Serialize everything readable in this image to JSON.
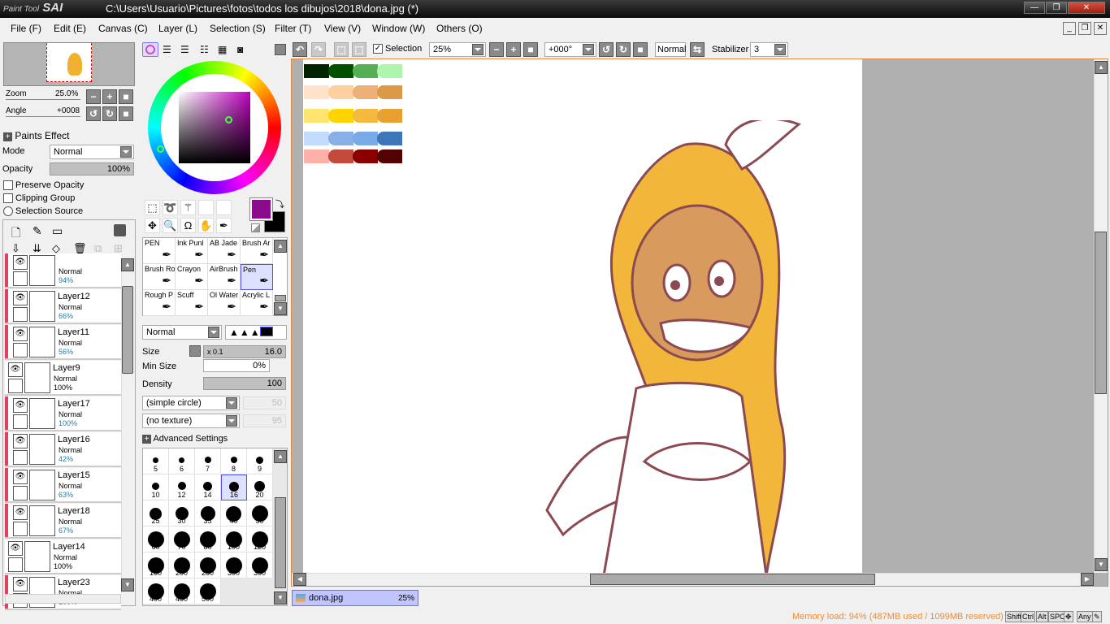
{
  "app": {
    "logo": "PaintTool SAI",
    "title": "C:\\Users\\Usuario\\Pictures\\fotos\\todos los dibujos\\2018\\dona.jpg (*)"
  },
  "menu": [
    "File (F)",
    "Edit (E)",
    "Canvas (C)",
    "Layer (L)",
    "Selection (S)",
    "Filter (T)",
    "View (V)",
    "Window (W)",
    "Others (O)"
  ],
  "navigator": {
    "zoom_label": "Zoom",
    "zoom_value": "25.0%",
    "angle_label": "Angle",
    "angle_value": "+0008"
  },
  "layer_props": {
    "paints_effect": "Paints Effect",
    "mode_label": "Mode",
    "mode_value": "Normal",
    "opacity_label": "Opacity",
    "opacity_value": "100%",
    "preserve_opacity": "Preserve Opacity",
    "clipping_group": "Clipping Group",
    "selection_source": "Selection Source"
  },
  "layers": [
    {
      "name": "",
      "mode": "Normal",
      "opacity": "94%",
      "tagged": true
    },
    {
      "name": "Layer12",
      "mode": "Normal",
      "opacity": "66%",
      "tagged": true
    },
    {
      "name": "Layer11",
      "mode": "Normal",
      "opacity": "56%",
      "tagged": true
    },
    {
      "name": "Layer9",
      "mode": "Normal",
      "opacity": "100%",
      "tagged": false
    },
    {
      "name": "Layer17",
      "mode": "Normal",
      "opacity": "100%",
      "tagged": true
    },
    {
      "name": "Layer16",
      "mode": "Normal",
      "opacity": "42%",
      "tagged": true
    },
    {
      "name": "Layer15",
      "mode": "Normal",
      "opacity": "63%",
      "tagged": true
    },
    {
      "name": "Layer18",
      "mode": "Normal",
      "opacity": "67%",
      "tagged": true
    },
    {
      "name": "Layer14",
      "mode": "Normal",
      "opacity": "100%",
      "tagged": false
    },
    {
      "name": "Layer23",
      "mode": "Normal",
      "opacity": "100%",
      "tagged": true
    }
  ],
  "colors": {
    "primary": "#8b0a8b",
    "secondary": "#000000",
    "accent": "#e08a40"
  },
  "brushes": [
    [
      "PEN",
      "Ink Punl",
      "AB Jade",
      "Brush Ar"
    ],
    [
      "Brush Ro",
      "Crayon",
      "AirBrush",
      "Pen"
    ],
    [
      "Rough P",
      "Scuff",
      "Ol Water",
      "Acrylic L"
    ]
  ],
  "brush_settings": {
    "blend_mode": "Normal",
    "size_label": "Size",
    "size_mult": "x 0.1",
    "size_value": "16.0",
    "min_size_label": "Min Size",
    "min_size_value": "0%",
    "density_label": "Density",
    "density_value": "100",
    "shape": "(simple circle)",
    "shape_value": "50",
    "texture": "(no texture)",
    "texture_value": "95",
    "advanced": "Advanced Settings"
  },
  "sizes": [
    "5",
    "6",
    "7",
    "8",
    "9",
    "10",
    "12",
    "14",
    "16",
    "20",
    "25",
    "30",
    "35",
    "40",
    "50",
    "60",
    "70",
    "80",
    "100",
    "120",
    "160",
    "200",
    "250",
    "300",
    "350",
    "400",
    "450",
    "500"
  ],
  "toolbar": {
    "selection_label": "Selection",
    "zoom": "25%",
    "angle": "+000°",
    "mode": "Normal",
    "stabilizer_label": "Stabilizer",
    "stabilizer_value": "3"
  },
  "palette": [
    [
      "#002200",
      "#005000",
      "#55b055",
      "#aef5ae"
    ],
    [
      "#ffe2c8",
      "#fdd0a0",
      "#ecb078",
      "#dc9a48"
    ],
    [
      "#ffe470",
      "#ffd400",
      "#f4ba40",
      "#e8a030"
    ],
    [
      "#c4dcfc",
      "#88b0e6",
      "#78aae6",
      "#3e76ba"
    ],
    [
      "#ffb0a8",
      "#c44a3c",
      "#8a0000",
      "#520000"
    ]
  ],
  "doc_tab": {
    "name": "dona.jpg",
    "zoom": "25%"
  },
  "status": {
    "memory": "Memory load: 94% (487MB used / 1099MB reserved)",
    "keys": [
      "Shift",
      "Ctrl",
      "Alt",
      "SPC",
      "✥",
      "Any",
      "✎"
    ]
  }
}
